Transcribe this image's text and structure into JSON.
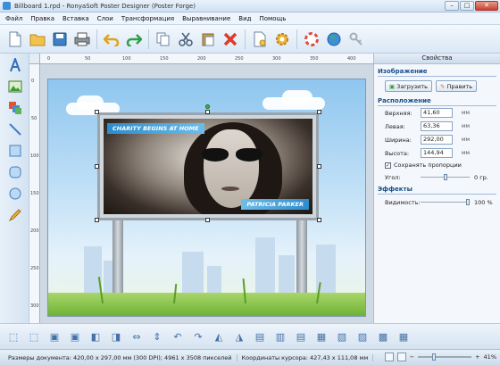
{
  "window": {
    "title": "Billboard 1.rpd - RonyaSoft Poster Designer (Poster Forge)",
    "btn_min": "–",
    "btn_max": "□",
    "btn_close": "✕"
  },
  "menu": [
    "Файл",
    "Правка",
    "Вставка",
    "Слои",
    "Трансформация",
    "Выравнивание",
    "Вид",
    "Помощь"
  ],
  "toolbar_icons": [
    "new-icon",
    "open-icon",
    "save-icon",
    "print-icon",
    "undo-icon",
    "redo-icon",
    "copy-icon",
    "cut-icon",
    "paste-icon",
    "delete-icon",
    "page-setup-icon",
    "settings-icon",
    "help-icon",
    "globe-icon",
    "key-icon"
  ],
  "left_tools": [
    "text-tool-icon",
    "image-tool-icon",
    "layers-tool-icon",
    "line-tool-icon",
    "rectangle-tool-icon",
    "rounded-rect-tool-icon",
    "ellipse-tool-icon",
    "pencil-tool-icon"
  ],
  "ruler": {
    "h_labels": [
      "0",
      "50",
      "100",
      "150",
      "200",
      "250",
      "300",
      "350",
      "400"
    ],
    "v_labels": [
      "0",
      "50",
      "100",
      "150",
      "200",
      "250",
      "300"
    ]
  },
  "canvas": {
    "banner_top": "CHARITY BEGINS AT HOME",
    "banner_bottom": "PATRICIA PARKER"
  },
  "props": {
    "header": "Свойства",
    "image_section": "Изображение",
    "load_button": "Загрузить",
    "edit_button": "Править",
    "position_section": "Расположение",
    "fields": [
      {
        "label": "Верхняя:",
        "value": "41,60",
        "unit": "мм"
      },
      {
        "label": "Левая:",
        "value": "63,36",
        "unit": "мм"
      },
      {
        "label": "Ширина:",
        "value": "292,00",
        "unit": "мм"
      },
      {
        "label": "Высота:",
        "value": "144,94",
        "unit": "мм"
      }
    ],
    "keep_proportions": "Сохранять пропорции",
    "keep_proportions_checked": true,
    "angle_label": "Угол:",
    "angle_value": "0 гр.",
    "effects_section": "Эффекты",
    "opacity_label": "Видимость:",
    "opacity_value": "100 %",
    "opacity_fraction": 1.0,
    "angle_fraction": 0.5
  },
  "bottom_icons": [
    "group-icon",
    "ungroup-icon",
    "bring-front-icon",
    "send-back-icon",
    "bring-forward-icon",
    "send-backward-icon",
    "fit-width-icon",
    "fit-height-icon",
    "rotate-left-icon",
    "rotate-right-icon",
    "flip-horizontal-icon",
    "flip-vertical-icon",
    "align-left-icon",
    "align-center-icon",
    "align-right-icon",
    "align-top-icon",
    "align-middle-icon",
    "align-bottom-icon",
    "distribute-horizontal-icon",
    "distribute-vertical-icon"
  ],
  "status": {
    "doc_size": "Размеры документа: 420,00 x 297,00 мм (300 DPI); 4961 x 3508 пикселей",
    "cursor": "Координаты курсора: 427,43 x 111,08 мм",
    "zoom": "41%",
    "zoom_fraction": 0.3
  }
}
